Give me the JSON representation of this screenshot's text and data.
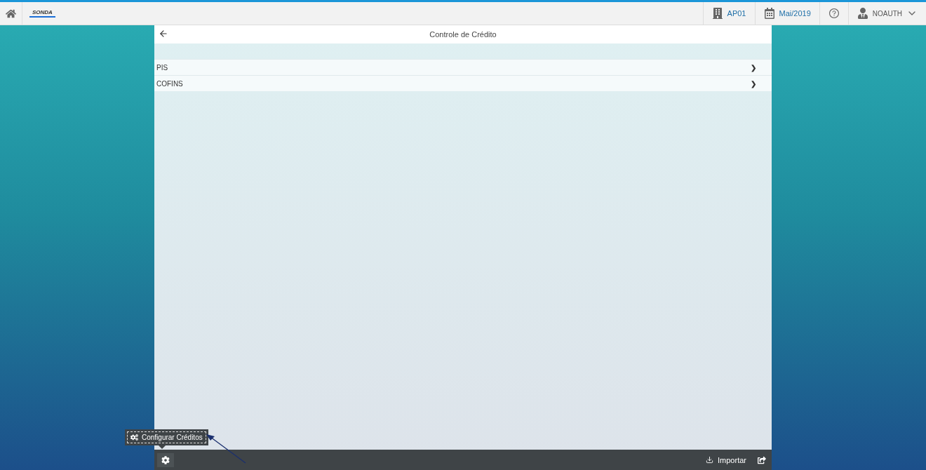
{
  "shell": {
    "logo": "SONDA",
    "company": "AP01",
    "period": "Mai/2019",
    "user": "NOAUTH"
  },
  "page": {
    "title": "Controle de Crédito"
  },
  "items": [
    {
      "label": "PIS",
      "chevron": "❯"
    },
    {
      "label": "COFINS",
      "chevron": "❯"
    }
  ],
  "footer": {
    "tooltip": "Configurar Créditos",
    "import_label": "Importar"
  }
}
